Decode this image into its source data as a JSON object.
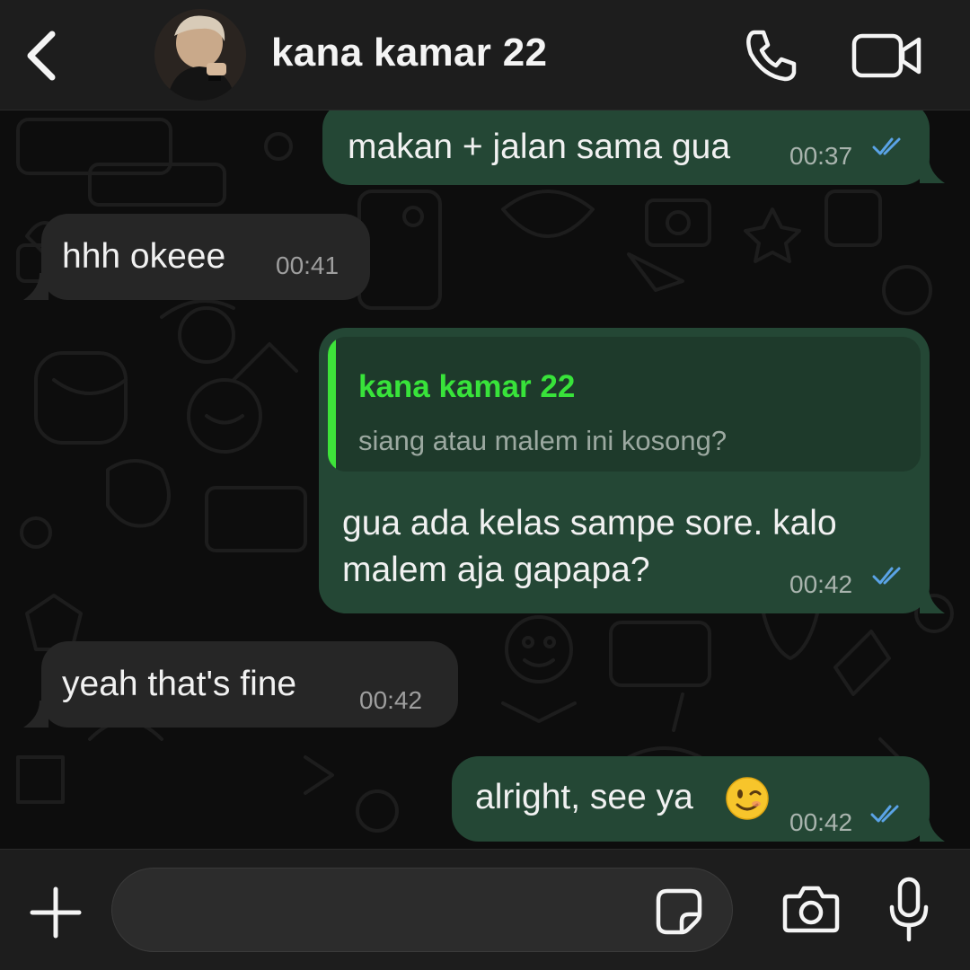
{
  "header": {
    "contact_name": "kana kamar 22",
    "back_icon": "chevron-left-icon",
    "call_icon": "phone-icon",
    "video_icon": "video-camera-icon"
  },
  "messages": [
    {
      "direction": "outgoing",
      "text": "makan + jalan sama gua",
      "time": "00:37",
      "status": "read"
    },
    {
      "direction": "incoming",
      "text": "hhh okeee",
      "time": "00:41"
    },
    {
      "direction": "outgoing",
      "reply_to": {
        "author": "kana kamar 22",
        "text": "siang atau malem ini kosong?"
      },
      "text_line1": "gua ada kelas sampe sore. kalo",
      "text_line2": "malem aja gapapa?",
      "time": "00:42",
      "status": "read"
    },
    {
      "direction": "incoming",
      "text": "yeah that's fine",
      "time": "00:42"
    },
    {
      "direction": "outgoing",
      "text": "alright, see ya",
      "emoji": "winking-face",
      "time": "00:42",
      "status": "read"
    }
  ],
  "composer": {
    "input_value": "",
    "plus_icon": "plus-icon",
    "sticker_icon": "sticker-icon",
    "camera_icon": "camera-icon",
    "mic_icon": "microphone-icon"
  },
  "colors": {
    "header_bg": "#1d1d1d",
    "outgoing_bubble": "#244735",
    "incoming_bubble": "#262626",
    "quote_accent": "#3ee33a",
    "read_ticks": "#5aa3e6"
  }
}
